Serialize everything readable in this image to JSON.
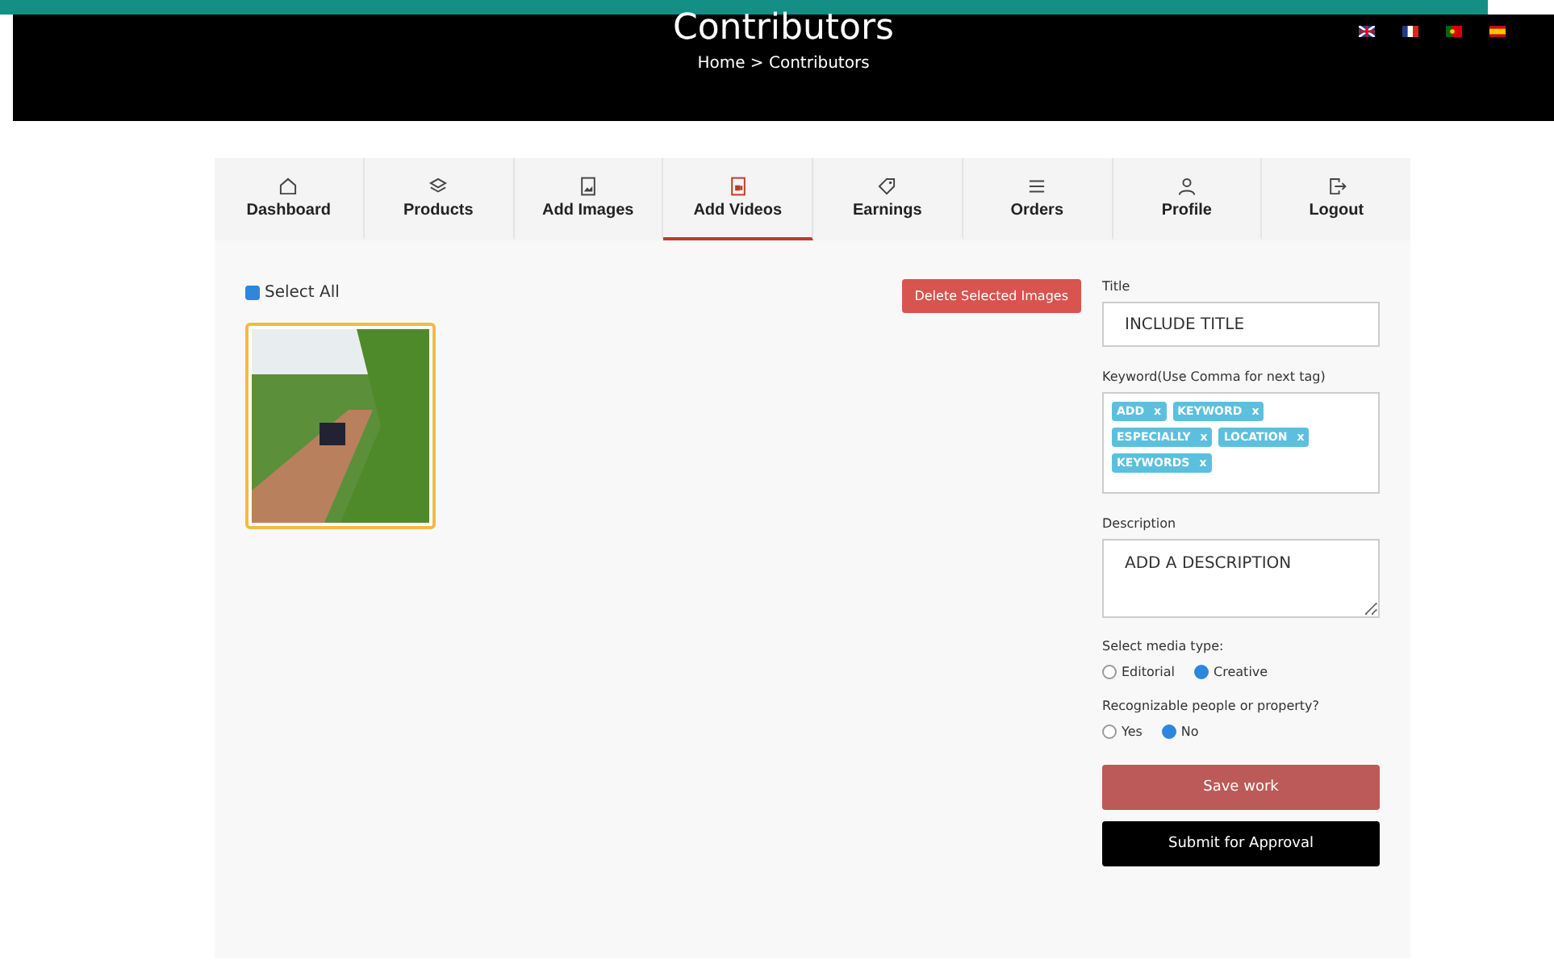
{
  "header": {
    "title": "Contributors",
    "breadcrumb": "Home > Contributors",
    "languages": [
      {
        "kind": "uk"
      },
      {
        "kind": "fr"
      },
      {
        "kind": "pt"
      },
      {
        "kind": "es"
      }
    ]
  },
  "tabs": [
    {
      "label": "Dashboard",
      "kind": "home",
      "selected": false
    },
    {
      "label": "Products",
      "kind": "layers",
      "selected": false
    },
    {
      "label": "Add Images",
      "kind": "image",
      "selected": false
    },
    {
      "label": "Add Videos",
      "kind": "video",
      "selected": true
    },
    {
      "label": "Earnings",
      "kind": "tag",
      "selected": false
    },
    {
      "label": "Orders",
      "kind": "list",
      "selected": false
    },
    {
      "label": "Profile",
      "kind": "user",
      "selected": false
    },
    {
      "label": "Logout",
      "kind": "logout",
      "selected": false
    }
  ],
  "gallery": {
    "select_all": {
      "label": "Select All",
      "checked": true
    },
    "delete_button": "Delete Selected Images",
    "items": [
      {
        "selected": true
      }
    ]
  },
  "form": {
    "title": {
      "label": "Title",
      "value": "INCLUDE TITLE"
    },
    "keywords": {
      "label": "Keyword(Use Comma for next tag)",
      "tags": [
        {
          "label": "ADD",
          "remove": "x"
        },
        {
          "label": "KEYWORD",
          "remove": "x"
        },
        {
          "label": "ESPECIALLY",
          "remove": "x"
        },
        {
          "label": "LOCATION",
          "remove": "x"
        },
        {
          "label": "KEYWORDS",
          "remove": "x"
        }
      ]
    },
    "description": {
      "label": "Description",
      "value": "ADD A DESCRIPTION"
    },
    "media_type": {
      "label": "Select media type:",
      "options": [
        {
          "label": "Editorial",
          "selected": false
        },
        {
          "label": "Creative",
          "selected": true
        }
      ]
    },
    "recognizable": {
      "label": "Recognizable people or property?",
      "options": [
        {
          "label": "Yes",
          "selected": false
        },
        {
          "label": "No",
          "selected": true
        }
      ]
    },
    "save_button": "Save work",
    "submit_button": "Submit for Approval"
  }
}
